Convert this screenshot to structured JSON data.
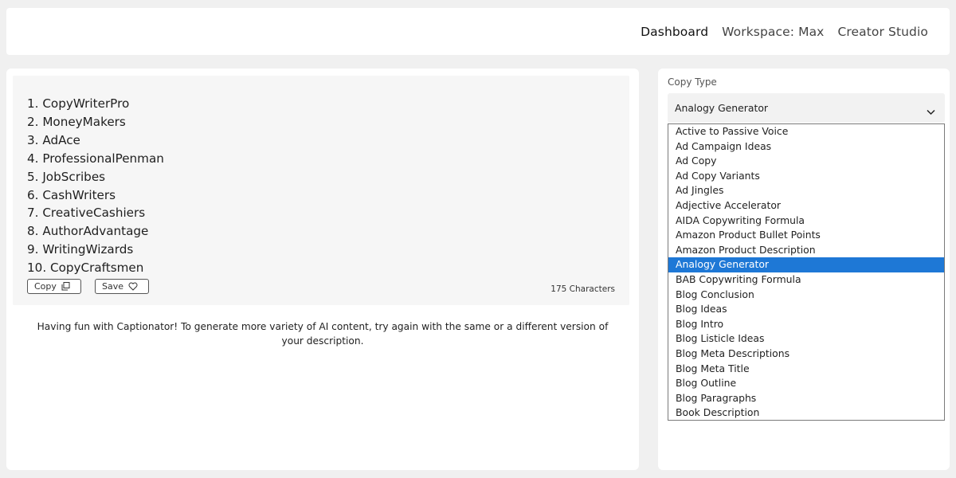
{
  "nav": {
    "dashboard": "Dashboard",
    "workspace": "Workspace: Max",
    "creator_studio": "Creator Studio"
  },
  "result": {
    "items": [
      "1. CopyWriterPro",
      "2. MoneyMakers",
      "3. AdAce",
      "4. ProfessionalPenman",
      "5. JobScribes",
      "6. CashWriters",
      "7. CreativeCashiers",
      "8. AuthorAdvantage",
      "9. WritingWizards",
      "10. CopyCraftsmen"
    ],
    "copy_label": "Copy",
    "save_label": "Save",
    "char_count": "175 Characters"
  },
  "info_text": "Having fun with Captionator! To generate more variety of AI content, try again with the same or a different version of your description.",
  "copy_type": {
    "label": "Copy Type",
    "selected": "Analogy Generator",
    "options": [
      "Active to Passive Voice",
      "Ad Campaign Ideas",
      "Ad Copy",
      "Ad Copy Variants",
      "Ad Jingles",
      "Adjective Accelerator",
      "AIDA Copywriting Formula",
      "Amazon Product Bullet Points",
      "Amazon Product Description",
      "Analogy Generator",
      "BAB Copywriting Formula",
      "Blog Conclusion",
      "Blog Ideas",
      "Blog Intro",
      "Blog Listicle Ideas",
      "Blog Meta Descriptions",
      "Blog Meta Title",
      "Blog Outline",
      "Blog Paragraphs",
      "Book Description"
    ],
    "highlighted_option": "Analogy Generator"
  },
  "colors": {
    "highlight": "#1e78d6",
    "background": "#f0f0f0"
  }
}
